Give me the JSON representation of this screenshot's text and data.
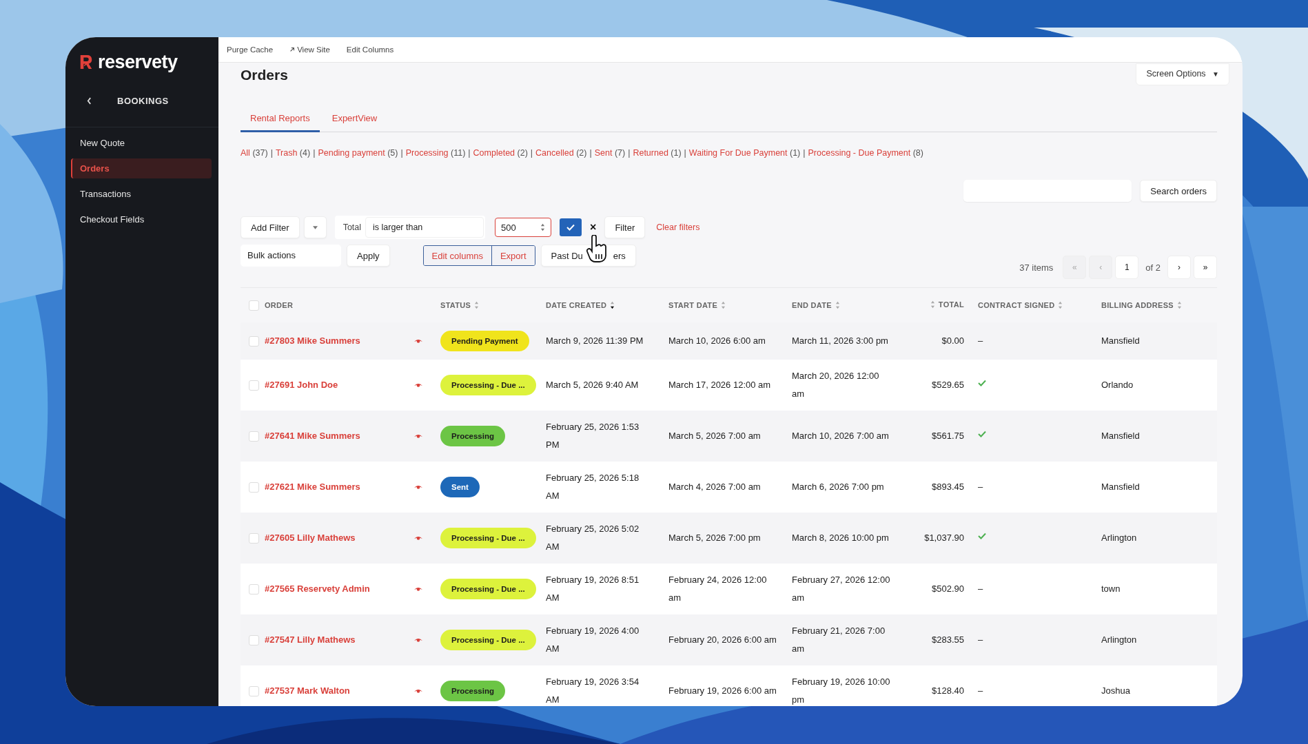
{
  "sidebar": {
    "logo": "reservety",
    "section": "BOOKINGS",
    "items": [
      {
        "label": "New Quote",
        "selected": false
      },
      {
        "label": "Orders",
        "selected": true
      },
      {
        "label": "Transactions",
        "selected": false
      },
      {
        "label": "Checkout Fields",
        "selected": false
      }
    ]
  },
  "top_bar": {
    "links": [
      {
        "label": "Purge Cache",
        "kind": "plain"
      },
      {
        "label": "View Site",
        "kind": "external"
      },
      {
        "label": "Edit Columns",
        "kind": "plain"
      }
    ]
  },
  "page_title": "Orders",
  "screen_options": {
    "label": "Screen Options",
    "caret": "▼"
  },
  "tabs": [
    {
      "label": "Rental Reports",
      "selected": true
    },
    {
      "label": "ExpertView",
      "selected": false
    }
  ],
  "status_filter": {
    "separator": "|",
    "items": [
      {
        "label": "All",
        "count": "(37)"
      },
      {
        "label": "Trash",
        "count": "(4)"
      },
      {
        "label": "Pending payment",
        "count": "(5)"
      },
      {
        "label": "Processing",
        "count": "(11)"
      },
      {
        "label": "Completed",
        "count": "(2)"
      },
      {
        "label": "Cancelled",
        "count": "(2)"
      },
      {
        "label": "Sent",
        "count": "(7)"
      },
      {
        "label": "Returned",
        "count": "(1)"
      },
      {
        "label": "Waiting For Due Payment",
        "count": "(1)"
      },
      {
        "label": "Processing - Due Payment",
        "count": "(8)"
      }
    ]
  },
  "search": {
    "button": "Search orders"
  },
  "filter": {
    "add_button": "Add Filter",
    "field_label": "Total",
    "operator": "is larger than",
    "value": "500",
    "close": "×",
    "apply_button": "Filter",
    "clear_link": "Clear filters"
  },
  "bulk": {
    "select": "Bulk actions",
    "apply": "Apply",
    "group": [
      "Edit columns",
      "Export"
    ],
    "past_due_start": "Past Du",
    "past_due_end": "ers"
  },
  "pagination": {
    "count": "37 items",
    "first": {
      "label": "«",
      "disabled": true
    },
    "prev": {
      "label": "‹",
      "disabled": true
    },
    "page": "1",
    "of": "of 2",
    "next": {
      "label": "›",
      "disabled": false
    },
    "last": {
      "label": "»",
      "disabled": false
    }
  },
  "table": {
    "columns": [
      {
        "label": "ORDER",
        "kind": "text"
      },
      {
        "label": "STATUS",
        "sorted": false,
        "kind": "text"
      },
      {
        "label": "DATE CREATED",
        "sorted": true,
        "kind": "text"
      },
      {
        "label": "START DATE",
        "sorted": false,
        "kind": "text"
      },
      {
        "label": "END DATE",
        "sorted": false,
        "kind": "text"
      },
      {
        "label": "TOTAL",
        "sorted": false,
        "kind": "numeric"
      },
      {
        "label": "CONTRACT SIGNED",
        "sorted": false,
        "kind": "text"
      },
      {
        "label": "BILLING ADDRESS",
        "sorted": false,
        "kind": "text"
      }
    ],
    "all_selected": false,
    "empty_mark": "–",
    "rows": [
      {
        "selected": false,
        "order": "#27803 Mike Summers",
        "status": {
          "label": "Pending Payment",
          "color": "#f0e41c"
        },
        "created": "March 9, 2026 11:39 PM",
        "start": "March 10, 2026 6:00 am",
        "end": "March 11, 2026 3:00 pm",
        "total": "$0.00",
        "contract_signed": false,
        "billing": "Mansfield"
      },
      {
        "selected": false,
        "order": "#27691 John Doe",
        "status": {
          "label": "Processing - Due ...",
          "color": "#ddf23c"
        },
        "created": "March 5, 2026 9:40 AM",
        "start": "March 17, 2026 12:00 am",
        "end": "March 20, 2026 12:00 am",
        "total": "$529.65",
        "contract_signed": true,
        "billing": "Orlando"
      },
      {
        "selected": false,
        "order": "#27641 Mike Summers",
        "status": {
          "label": "Processing",
          "color": "#6cc545"
        },
        "created": "February 25, 2026 1:53 PM",
        "start": "March 5, 2026 7:00 am",
        "end": "March 10, 2026 7:00 am",
        "total": "$561.75",
        "contract_signed": true,
        "billing": "Mansfield"
      },
      {
        "selected": false,
        "order": "#27621 Mike Summers",
        "status": {
          "label": "Sent",
          "color": "#1d68b8"
        },
        "created": "February 25, 2026 5:18 AM",
        "start": "March 4, 2026 7:00 am",
        "end": "March 6, 2026 7:00 pm",
        "total": "$893.45",
        "contract_signed": false,
        "billing": "Mansfield"
      },
      {
        "selected": false,
        "order": "#27605 Lilly Mathews",
        "status": {
          "label": "Processing - Due ...",
          "color": "#ddf23c"
        },
        "created": "February 25, 2026 5:02 AM",
        "start": "March 5, 2026 7:00 pm",
        "end": "March 8, 2026 10:00 pm",
        "total": "$1,037.90",
        "contract_signed": true,
        "billing": "Arlington"
      },
      {
        "selected": false,
        "order": "#27565 Reservety Admin",
        "status": {
          "label": "Processing - Due ...",
          "color": "#ddf23c"
        },
        "created": "February 19, 2026 8:51 AM",
        "start": "February 24, 2026 12:00 am",
        "end": "February 27, 2026 12:00 am",
        "total": "$502.90",
        "contract_signed": false,
        "billing": "town"
      },
      {
        "selected": false,
        "order": "#27547 Lilly Mathews",
        "status": {
          "label": "Processing - Due ...",
          "color": "#ddf23c"
        },
        "created": "February 19, 2026 4:00 AM",
        "start": "February 20, 2026 6:00 am",
        "end": "February 21, 2026 7:00 am",
        "total": "$283.55",
        "contract_signed": false,
        "billing": "Arlington"
      },
      {
        "selected": false,
        "order": "#27537 Mark Walton",
        "status": {
          "label": "Processing",
          "color": "#6cc545"
        },
        "created": "February 19, 2026 3:54 AM",
        "start": "February 19, 2026 6:00 am",
        "end": "February 19, 2026 10:00 pm",
        "total": "$128.40",
        "contract_signed": false,
        "billing": "Joshua"
      }
    ]
  }
}
